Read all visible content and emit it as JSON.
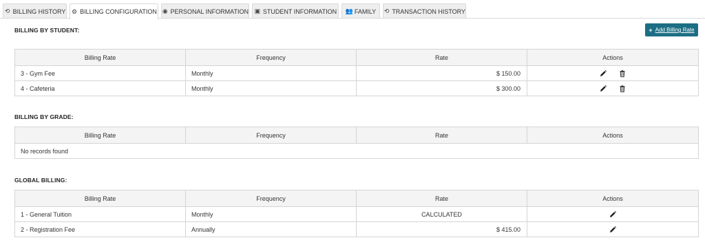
{
  "tabs": [
    {
      "label": "BILLING HISTORY",
      "icon": "history-icon",
      "glyph": "⟲",
      "active": false
    },
    {
      "label": "BILLING CONFIGURATION",
      "icon": "gear-icon",
      "glyph": "⚙",
      "active": true
    },
    {
      "label": "PERSONAL INFORMATION",
      "icon": "user-circle-icon",
      "glyph": "◉",
      "active": false
    },
    {
      "label": "STUDENT INFORMATION",
      "icon": "id-card-icon",
      "glyph": "▣",
      "active": false
    },
    {
      "label": "FAMILY",
      "icon": "users-icon",
      "glyph": "👥",
      "active": false
    },
    {
      "label": "TRANSACTION HISTORY",
      "icon": "history-icon",
      "glyph": "⟲",
      "active": false
    }
  ],
  "add_button": {
    "plus": "+",
    "label": "Add Billing Rate"
  },
  "columns": [
    "Billing Rate",
    "Frequency",
    "Rate",
    "Actions"
  ],
  "sections": {
    "by_student": {
      "title": "BILLING BY STUDENT:",
      "rows": [
        {
          "billing_rate": "3 - Gym Fee",
          "frequency": "Monthly",
          "rate": "$ 150.00"
        },
        {
          "billing_rate": "4 - Cafeteria",
          "frequency": "Monthly",
          "rate": "$ 300.00"
        }
      ]
    },
    "by_grade": {
      "title": "BILLING BY GRADE:",
      "empty_text": "No records found"
    },
    "global": {
      "title": "GLOBAL BILLING:",
      "rows": [
        {
          "billing_rate": "1 - General Tuition",
          "frequency": "Monthly",
          "rate": "CALCULATED"
        },
        {
          "billing_rate": "2 - Registration Fee",
          "frequency": "Annually",
          "rate": "$ 415.00"
        }
      ]
    }
  },
  "colors": {
    "accent": "#1c6e84",
    "border": "#d4d4d4",
    "header_bg": "#f4f4f4"
  }
}
